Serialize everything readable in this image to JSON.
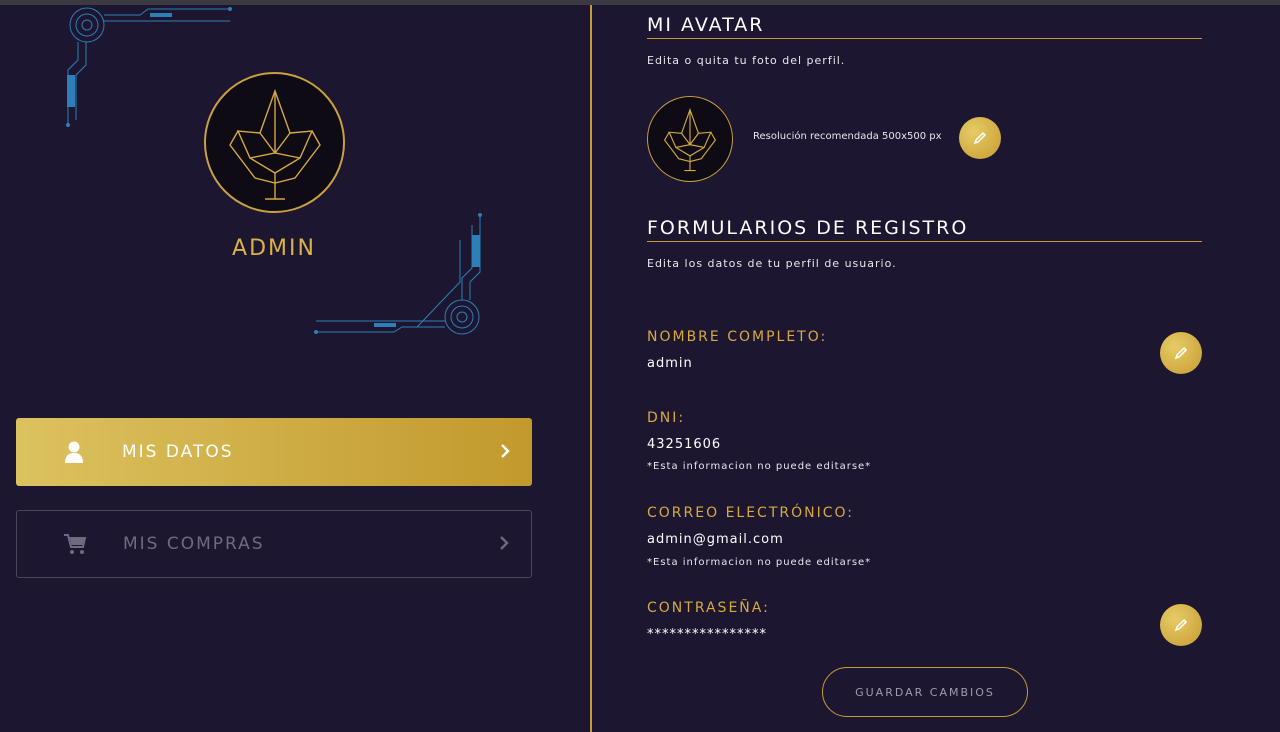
{
  "sidebar": {
    "username": "ADMIN",
    "menu": [
      {
        "label": "MIS DATOS",
        "icon": "user-icon",
        "active": true
      },
      {
        "label": "MIS COMPRAS",
        "icon": "cart-icon",
        "active": false
      }
    ]
  },
  "avatar_section": {
    "title": "MI AVATAR",
    "description": "Edita o quita tu foto del perfil.",
    "resolution_note": "Resolución recomendada 500x500 px"
  },
  "form_section": {
    "title": "FORMULARIOS DE REGISTRO",
    "description": "Edita los datos de tu perfil de usuario.",
    "fields": [
      {
        "label": "NOMBRE COMPLETO:",
        "value": "admin",
        "note": "",
        "editable": true
      },
      {
        "label": "DNI:",
        "value": "43251606",
        "note": "*Esta informacion no puede editarse*",
        "editable": false
      },
      {
        "label": "CORREO ELECTRÓNICO:",
        "value": "admin@gmail.com",
        "note": "*Esta informacion no puede editarse*",
        "editable": false
      },
      {
        "label": "CONTRASEÑA:",
        "value": "****************",
        "note": "",
        "editable": true
      }
    ],
    "save_label": "GUARDAR CAMBIOS"
  },
  "colors": {
    "background": "#1c1630",
    "accent_gold": "#c99b32",
    "circuit_blue": "#2e7fb8"
  }
}
